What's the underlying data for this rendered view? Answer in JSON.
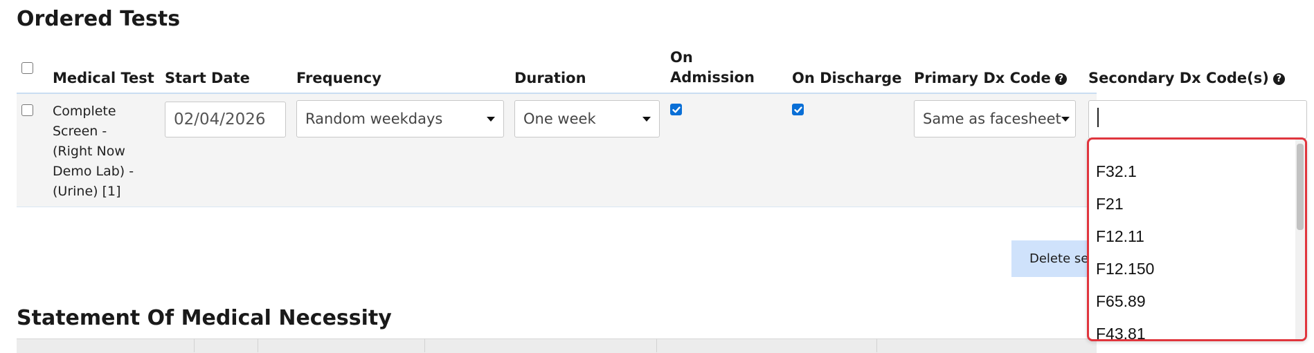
{
  "section_titles": {
    "ordered_tests": "Ordered Tests",
    "statement": "Statement Of Medical Necessity"
  },
  "table": {
    "headers": {
      "medical_test": "Medical Test",
      "start_date": "Start Date",
      "frequency": "Frequency",
      "duration": "Duration",
      "on_admission_1": "On",
      "on_admission_2": "Admission",
      "on_discharge": "On Discharge",
      "primary_dx": "Primary Dx Code",
      "secondary_dx": "Secondary Dx Code(s)"
    },
    "row": {
      "test_lines": [
        "Complete",
        "Screen -",
        "(Right Now",
        "Demo Lab) -",
        "(Urine) [1]"
      ],
      "start_date": "02/04/2026",
      "frequency": "Random weekdays",
      "duration": "One week",
      "on_admission": true,
      "on_discharge": true,
      "primary_dx": "Same as facesheet",
      "secondary_dx_value": ""
    }
  },
  "buttons": {
    "delete_selected": "Delete se"
  },
  "dropdown": {
    "options": [
      "F32.1",
      "F21",
      "F12.11",
      "F12.150",
      "F65.89",
      "F43.81"
    ]
  },
  "colors": {
    "accent": "#0a6fd6",
    "highlight_border": "#e0353d",
    "button_bg": "#cfe2fb"
  }
}
